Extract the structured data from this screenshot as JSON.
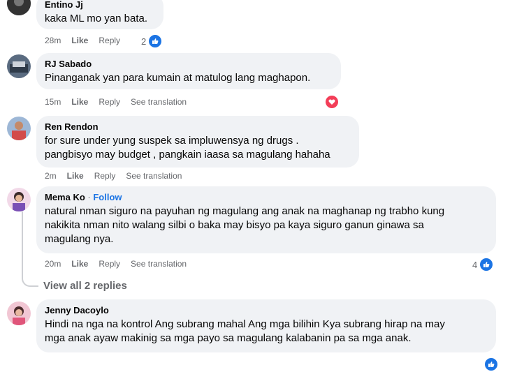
{
  "comments": [
    {
      "author": "Entino Jj",
      "text": "kaka ML mo yan bata.",
      "time": "28m",
      "like": "Like",
      "reply": "Reply",
      "reaction_count": "2"
    },
    {
      "author": "RJ Sabado",
      "text": "Pinanganak yan para kumain at matulog lang maghapon.",
      "time": "15m",
      "like": "Like",
      "reply": "Reply",
      "see_translation": "See translation"
    },
    {
      "author": "Ren Rendon",
      "text_lines": [
        "for sure under yung suspek sa impluwensya ng drugs .",
        "pangbisyo may budget , pangkain iaasa sa magulang hahaha"
      ],
      "time": "2m",
      "like": "Like",
      "reply": "Reply",
      "see_translation": "See translation"
    },
    {
      "author": "Mema Ko",
      "follow": "Follow",
      "text_lines": [
        "natural nman siguro na payuhan ng magulang ang anak na maghanap ng trabho kung",
        "nakikita nman nito walang silbi o baka may bisyo pa kaya siguro ganun ginawa sa",
        "magulang nya."
      ],
      "time": "20m",
      "like": "Like",
      "reply": "Reply",
      "see_translation": "See translation",
      "reaction_count": "4",
      "view_replies": "View all 2 replies"
    },
    {
      "author": "Jenny Dacoylo",
      "text_lines": [
        "Hindi na nga na kontrol Ang subrang mahal Ang mga bilihin Kya subrang hirap na may",
        "mga anak ayaw makinig sa mga payo sa magulang kalabanin pa sa mga anak."
      ]
    }
  ],
  "colors": {
    "bubble": "#f0f2f5",
    "meta": "#65676b",
    "link": "#1b74e4",
    "like_badge": "#1b74e4",
    "love_badge": "#f33e58"
  },
  "icons": {
    "like": "thumbs-up-icon",
    "love": "heart-icon"
  }
}
